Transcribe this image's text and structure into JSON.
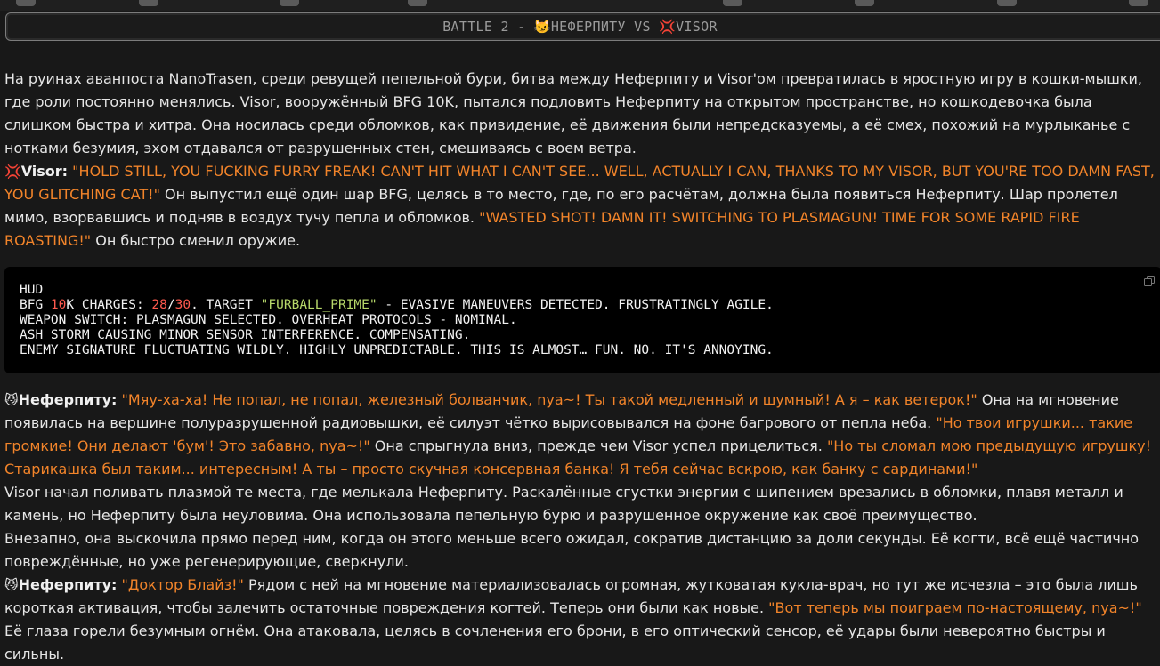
{
  "banner": {
    "prefix": "BATTLE 2 - ",
    "fighter1": "НЕФЕРПИТУ",
    "vs": " VS ",
    "fighter2": "VISOR"
  },
  "para1": {
    "text": "На руинах аванпоста NanoTrasen, среди ревущей пепельной бури, битва между Неферпиту и Visor'ом превратилась в яростную игру в кошки-мышки, где роли постоянно менялись. Visor, вооружённый BFG 10K, пытался подловить Неферпиту на открытом пространстве, но кошкодевочка была слишком быстра и хитра. Она носилась среди обломков, как привидение, её движения были непредсказуемы, а её смех, похожий на мурлыканье с нотками безумия, эхом отдавался от разрушенных стен, смешиваясь с воем ветра."
  },
  "visor_line": {
    "name": "Visor:",
    "quote1": "\"HOLD STILL, YOU FUCKING FURRY FREAK! CAN'T HIT WHAT I CAN'T SEE... WELL, ACTUALLY I CAN, THANKS TO MY VISOR, BUT YOU'RE TOO DAMN FAST, YOU GLITCHING CAT!\"",
    "narr1": " Он выпустил ещё один шар BFG, целясь в то место, где, по его расчётам, должна была появиться Неферпиту. Шар пролетел мимо, взорвавшись и подняв в воздух тучу пепла и обломков. ",
    "quote2": "\"WASTED SHOT! DAMN IT! SWITCHING TO PLASMAGUN! TIME FOR SOME RAPID FIRE ROASTING!\"",
    "narr2": " Он быстро сменил оружие."
  },
  "hud": {
    "title": "HUD",
    "l1_a": "BFG ",
    "l1_num1": "10",
    "l1_b": "K CHARGES: ",
    "l1_num2": "28",
    "l1_c": "/",
    "l1_num3": "30",
    "l1_d": ". TARGET ",
    "l1_str": "\"FURBALL_PRIME\"",
    "l1_e": " - EVASIVE MANEUVERS DETECTED. FRUSTRATINGLY AGILE.",
    "l2": "WEAPON SWITCH: PLASMAGUN SELECTED. OVERHEAT PROTOCOLS - NOMINAL.",
    "l3": "ASH STORM CAUSING MINOR SENSOR INTERFERENCE. COMPENSATING.",
    "l4": "ENEMY SIGNATURE FLUCTUATING WILDLY. HIGHLY UNPREDICTABLE. THIS IS ALMOST… FUN. NO. IT'S ANNOYING."
  },
  "nef_line1": {
    "name": "Неферпиту:",
    "q1": "\"Мяу-ха-ха! Не попал, не попал, железный болванчик, nya~! Ты такой медленный и шумный! А я – как ветерок!\"",
    "n1": " Она на мгновение появилась на вершине полуразрушенной радиовышки, её силуэт чётко вырисовывался на фоне багрового от пепла неба. ",
    "q2": "\"Но твои игрушки... такие громкие! Они делают 'бум'! Это забавно, nya~!\"",
    "n2": " Она спрыгнула вниз, прежде чем Visor успел прицелиться. ",
    "q3": "\"Но ты сломал мою предыдущую игрушку! Старикашка был таким... интересным! А ты – просто скучная консервная банка! Я тебя сейчас вскрою, как банку с сардинами!\""
  },
  "para2": {
    "text": "Visor начал поливать плазмой те места, где мелькала Неферпиту. Раскалённые сгустки энергии с шипением врезались в обломки, плавя металл и камень, но Неферпиту была неуловима. Она использовала пепельную бурю и разрушенное окружение как своё преимущество."
  },
  "para3": {
    "text": "Внезапно, она выскочила прямо перед ним, когда он этого меньше всего ожидал, сократив дистанцию за доли секунды. Её когти, всё ещё частично повреждённые, но уже регенерирующие, сверкнули."
  },
  "nef_line2": {
    "name": "Неферпиту:",
    "q1": "\"Доктор Блайз!\"",
    "n1": " Рядом с ней на мгновение материализовалась огромная, жутковатая кукла-врач, но тут же исчезла – это была лишь короткая активация, чтобы залечить остаточные повреждения когтей. Теперь они были как новые. ",
    "q2": "\"Вот теперь мы поиграем по-настоящему, nya~!\"",
    "n2": " Её глаза горели безумным огнём. Она атаковала, целясь в сочленения его брони, в его оптический сенсор, её удары были невероятно быстры и сильны."
  },
  "icons": {
    "cat": "cat-emoji-icon",
    "anger": "anger-emoji-icon",
    "copy": "copy-icon"
  },
  "colors": {
    "quote": "#f2842a",
    "hud_number": "#ff5a4e",
    "hud_string": "#b7d86a"
  }
}
